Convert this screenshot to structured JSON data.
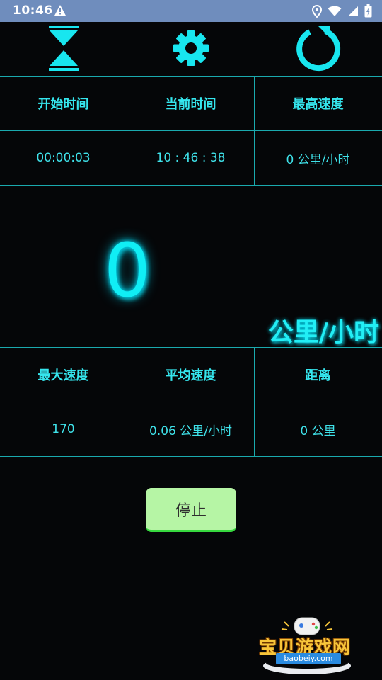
{
  "status_bar": {
    "time": "10:46",
    "icons": [
      "warning-icon",
      "location-icon",
      "wifi-icon",
      "signal-icon",
      "battery-icon"
    ]
  },
  "toolbar": {
    "buttons": [
      "hourglass-icon",
      "gear-icon",
      "refresh-icon"
    ],
    "accent_color": "#18e6ef"
  },
  "top_table": {
    "headers": [
      "开始时间",
      "当前时间",
      "最高速度"
    ],
    "values": [
      "00:00:03",
      "10 : 46 : 38",
      "0 公里/小时"
    ]
  },
  "speedometer": {
    "value": "0",
    "unit": "公里/小时"
  },
  "bottom_table": {
    "headers": [
      "最大速度",
      "平均速度",
      "距离"
    ],
    "values": [
      "170",
      "0.06 公里/小时",
      "0 公里"
    ]
  },
  "actions": {
    "stop_label": "停止"
  },
  "watermark": {
    "text": "宝贝游戏网",
    "url": "baobeiy.com"
  }
}
